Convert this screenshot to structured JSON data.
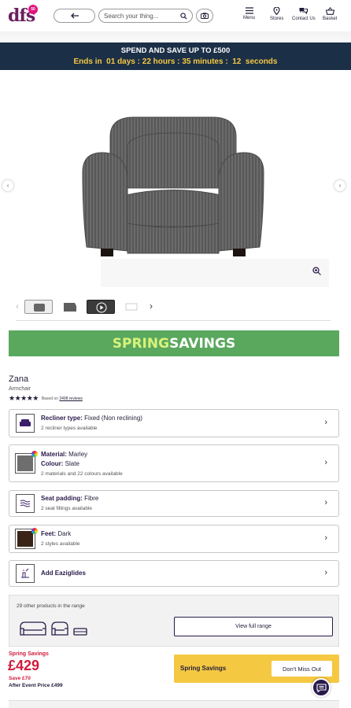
{
  "header": {
    "logo_text": "dfs",
    "logo_badge": "50",
    "search_placeholder": "Search your thing...",
    "nav": [
      {
        "label": "Menu",
        "icon": "menu-icon"
      },
      {
        "label": "Stores",
        "icon": "location-pin-icon"
      },
      {
        "label": "Contact Us",
        "icon": "chat-bubbles-icon"
      },
      {
        "label": "Basket",
        "icon": "basket-icon"
      }
    ]
  },
  "promo": {
    "line1": "SPEND AND SAVE UP TO £500",
    "line2": "Ends in  01 days : 22 hours : 35 minutes :  12  seconds"
  },
  "spring_banner": {
    "word1": "SPRING",
    "word2": "SAVINGS"
  },
  "product": {
    "name": "Zana",
    "category": "Armchair",
    "stars": "★★★★★",
    "rating_value": 4.5,
    "reviews_prefix": "Based on",
    "reviews_link": "2498 reviews"
  },
  "options": [
    {
      "title": "Recliner type:",
      "value": "Fixed (Non reclining)",
      "sub": "2 recliner types available",
      "icon": "armchair-icon"
    },
    {
      "title": "Material:",
      "value": "Marley",
      "title2": "Colour:",
      "value2": "Slate",
      "sub": "2 materials and 22 colours available",
      "icon": "fabric-swatch-icon",
      "swatch_color": "#6e6e6e"
    },
    {
      "title": "Seat padding:",
      "value": "Fibre",
      "sub": "2 seat fillings available",
      "icon": "padding-icon"
    },
    {
      "title": "Feet:",
      "value": "Dark",
      "sub": "2 styles available",
      "icon": "feet-swatch-icon",
      "swatch_color": "#3a2418"
    },
    {
      "title": "Add Eaziglides",
      "value": "",
      "sub": "",
      "icon": "eaziglides-icon"
    }
  ],
  "range": {
    "text": "29 other products in the range",
    "button": "View full range"
  },
  "price": {
    "label": "Spring Savings",
    "amount": "£429",
    "save": "Save £70",
    "after": "After Event Price £499"
  },
  "offer": {
    "label": "Spring Savings",
    "button": "Don't Miss Out"
  },
  "colors": {
    "brand": "#6b1f5e",
    "navy": "#1b2f47",
    "green": "#5aa85e",
    "red": "#d01c3c",
    "yellow": "#f5c842"
  }
}
